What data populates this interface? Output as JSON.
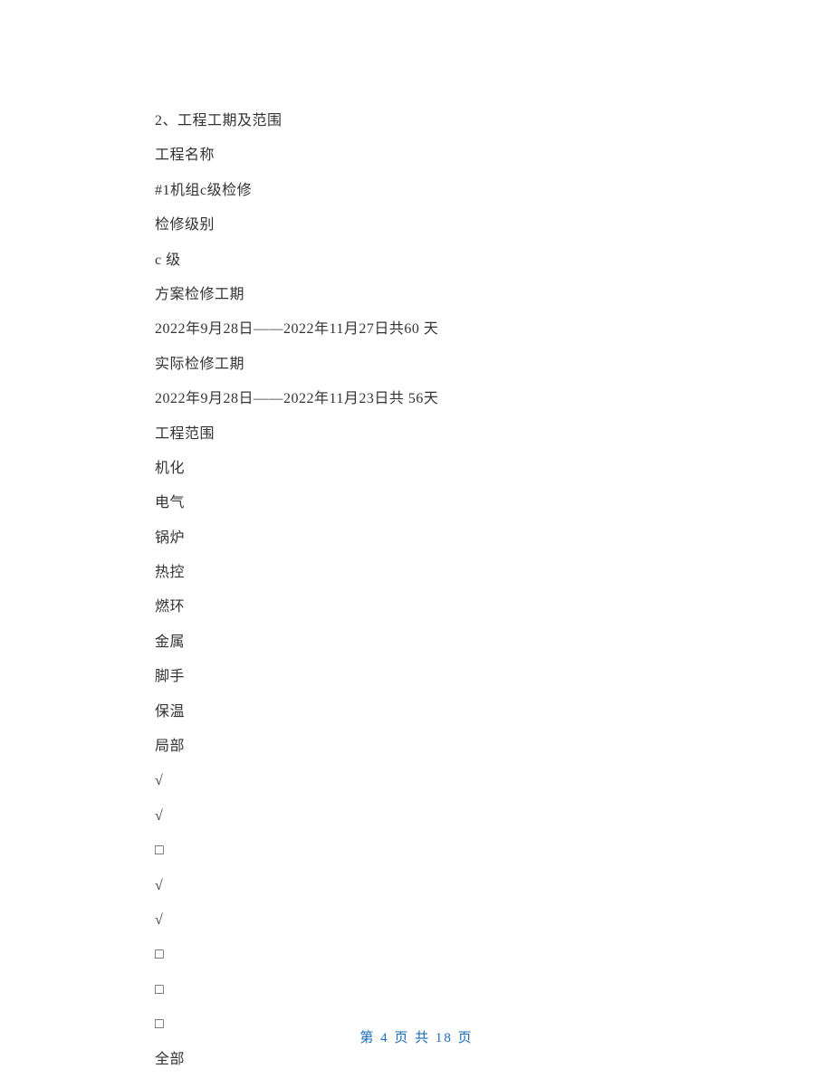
{
  "lines": [
    "2、工程工期及范围",
    "工程名称",
    "#1机组c级检修",
    "检修级别",
    "c 级",
    "方案检修工期",
    "2022年9月28日——2022年11月27日共60 天",
    "实际检修工期",
    "2022年9月28日——2022年11月23日共 56天",
    "工程范围",
    "机化",
    "电气",
    "锅炉",
    "热控",
    "燃环",
    "金属",
    "脚手",
    "保温",
    "局部",
    "√",
    "√",
    "□",
    "√",
    "√",
    "□",
    "□",
    "□",
    "全部"
  ],
  "footer": "第 4 页 共 18 页"
}
